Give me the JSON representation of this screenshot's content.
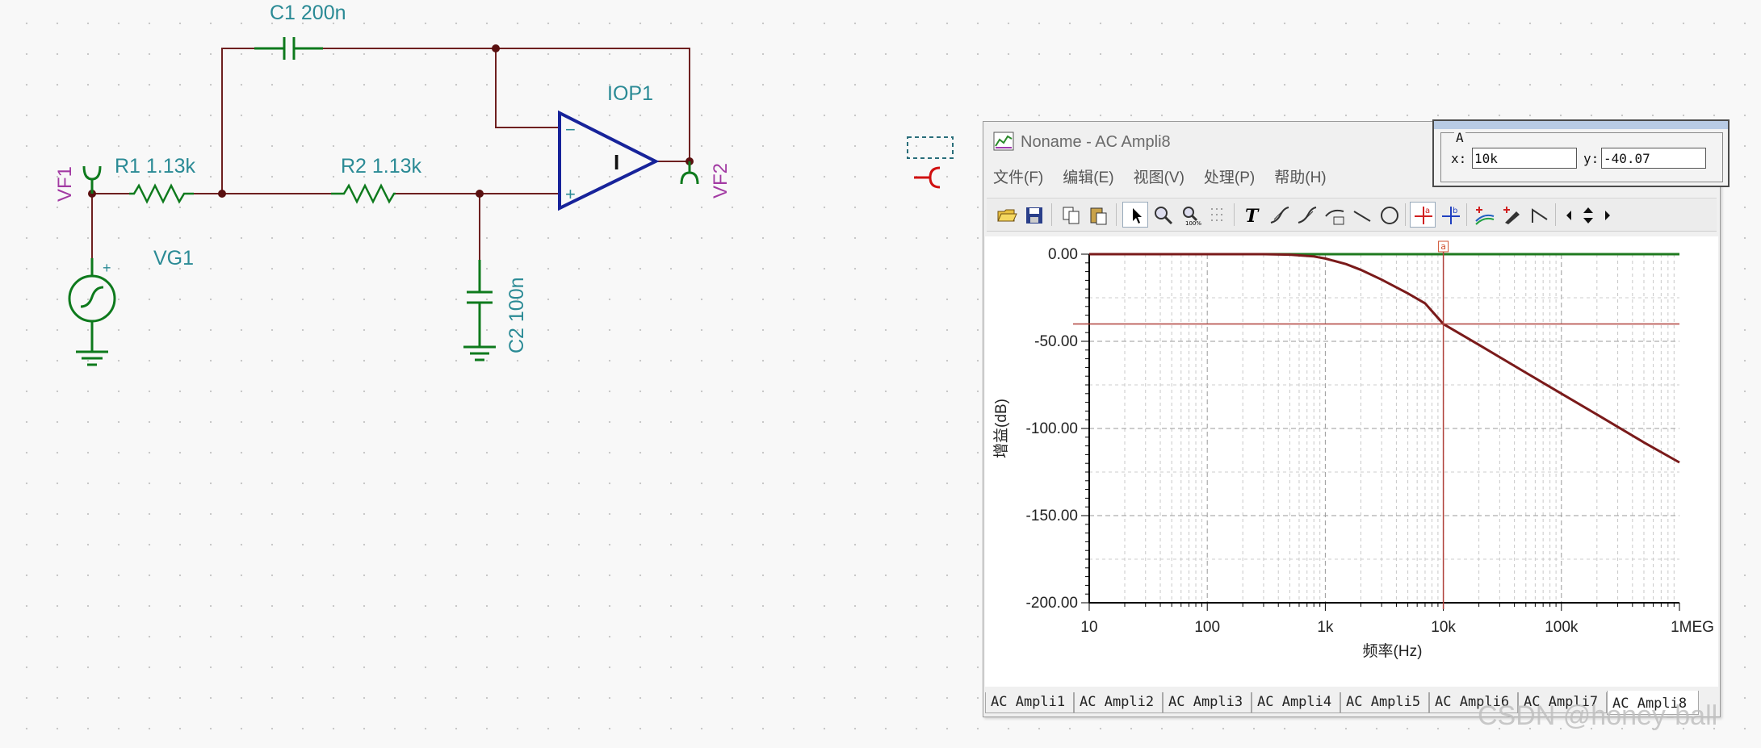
{
  "schematic": {
    "labels": {
      "c1": "C1 200n",
      "iop1": "IOP1",
      "r1": "R1 1.13k",
      "r2": "R2 1.13k",
      "vg1": "VG1",
      "c2": "C2 100n",
      "vf1": "VF1",
      "vf2": "VF2",
      "opamp_mark": "I",
      "plus": "+",
      "minus": "−"
    },
    "colors": {
      "wire": "#6e2020",
      "component": "#0e7a1d",
      "label": "#2a8a95",
      "meter": "#a23aa3",
      "opamp": "#17239a"
    }
  },
  "window": {
    "title": "Noname - AC Ampli8",
    "menu": [
      "文件(F)",
      "编辑(E)",
      "视图(V)",
      "处理(P)",
      "帮助(H)"
    ],
    "toolbar": [
      "open-icon",
      "save-icon",
      "copy-icon",
      "paste-icon",
      "pointer-icon",
      "zoom-in-icon",
      "zoom-100-icon",
      "grid-icon",
      "text-icon",
      "cursor-a-icon",
      "cursor-b-icon",
      "curve-label-icon",
      "line-icon",
      "circle-icon",
      "cursor-a-cross-icon",
      "cursor-b-cross-icon",
      "add-curve-icon",
      "marker-pen-icon",
      "arrow-line-icon",
      "scroll-left-icon",
      "scroll-updown-icon",
      "scroll-right-icon"
    ],
    "tabs": [
      "AC Ampli1",
      "AC Ampli2",
      "AC Ampli3",
      "AC Ampli4",
      "AC Ampli5",
      "AC Ampli6",
      "AC Ampli7",
      "AC Ampli8"
    ],
    "active_tab": "AC Ampli8"
  },
  "cursor": {
    "group": "A",
    "x_label": "x:",
    "x_value": "10k",
    "y_label": "y:",
    "y_value": "-40.07",
    "marker": "a"
  },
  "watermark": "CSDN @honey-ball",
  "chart_data": {
    "type": "line",
    "xlabel": "频率(Hz)",
    "ylabel": "增益(dB)",
    "x_scale": "log",
    "xlim": [
      10,
      1000000
    ],
    "ylim": [
      -200,
      0
    ],
    "x_ticks": [
      "10",
      "100",
      "1k",
      "10k",
      "100k",
      "1MEG"
    ],
    "y_ticks": [
      "0.00",
      "-50.00",
      "-100.00",
      "-150.00",
      "-200.00"
    ],
    "grid": true,
    "series": [
      {
        "color": "#7a1a1a",
        "x": [
          10,
          100,
          300,
          500,
          800,
          1000,
          1500,
          2000,
          3000,
          5000,
          7000,
          10000,
          20000,
          50000,
          100000,
          200000,
          500000,
          1000000
        ],
        "y": [
          0,
          0,
          0,
          -0.3,
          -1.3,
          -2.5,
          -5.7,
          -9.0,
          -14.6,
          -22.5,
          -28.2,
          -40.07,
          -52.0,
          -68.0,
          -80.0,
          -92.0,
          -108.0,
          -119.5
        ]
      },
      {
        "color": "#1f7a1f",
        "x": [
          10,
          1000000
        ],
        "y": [
          0,
          0
        ]
      }
    ],
    "cursor_x": 10000,
    "cursor_y": -40.07
  }
}
